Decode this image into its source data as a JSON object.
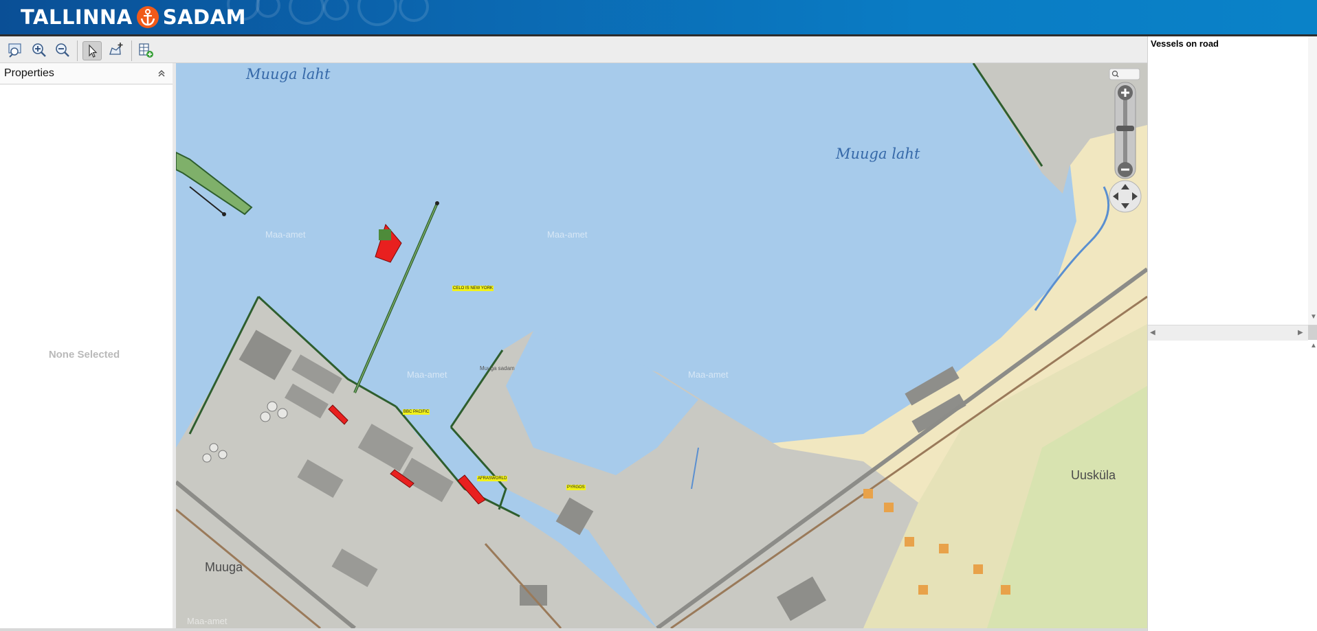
{
  "header": {
    "brand_left": "TALLINNA",
    "brand_right": "SADAM",
    "logo_icon": "anchor-icon",
    "colors": {
      "header_start": "#0a4f96",
      "header_end": "#0a82c8",
      "logo_circle": "#f05a1a"
    }
  },
  "toolbar": {
    "buttons": [
      {
        "name": "zoom-to-extent-icon"
      },
      {
        "name": "zoom-in-icon"
      },
      {
        "name": "zoom-out-icon"
      },
      {
        "name": "select-pointer-icon",
        "active": true
      },
      {
        "name": "add-feature-icon"
      },
      {
        "name": "export-table-icon"
      }
    ]
  },
  "properties": {
    "title": "Properties",
    "empty_text": "None Selected",
    "collapse_icon": "double-chevron-up-icon"
  },
  "map": {
    "water_labels": [
      "Muuga laht",
      "Muuga laht"
    ],
    "watermark": "Maa-amet",
    "places": {
      "muuga": "Muuga",
      "uuskula": "Uusküla"
    },
    "harbour_label": "Muuga sadam",
    "vessels": [
      {
        "name": "CELO IS NEW YORK"
      },
      {
        "name": "BBC PACIFIC"
      },
      {
        "name": "AFRASWORLD"
      },
      {
        "name": "PYRGOS"
      }
    ],
    "controls": {
      "search_icon": "search-icon",
      "zoom_in": "plus-icon",
      "zoom_out": "minus-icon",
      "pan": "pan-arrows-icon"
    },
    "colors": {
      "water": "#a7cbeb",
      "land": "#c9c9c3",
      "sand": "#f1e7c0",
      "pier": "#4e8b3a",
      "vessel": "#e8201f",
      "vessel_label": "#f2f21a"
    }
  },
  "right_panel": {
    "title": "Vessels on road"
  }
}
